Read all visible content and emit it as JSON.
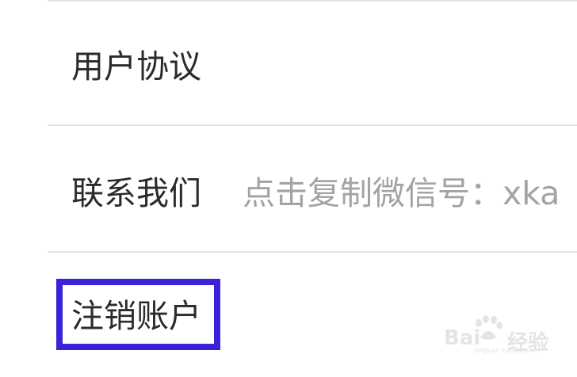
{
  "settings": {
    "items": [
      {
        "label": "用户协议"
      },
      {
        "label": "联系我们",
        "value": "点击复制微信号：xka"
      },
      {
        "label": "注销账户"
      }
    ]
  },
  "watermark": {
    "brand": "Bai",
    "brand_tail": "经验",
    "site": "jingyan.baidu.com"
  },
  "colors": {
    "highlight_border": "#3a22d6",
    "divider": "#e3e3e3",
    "label_text": "#2b2b2b",
    "value_text": "#a3a3a3"
  }
}
